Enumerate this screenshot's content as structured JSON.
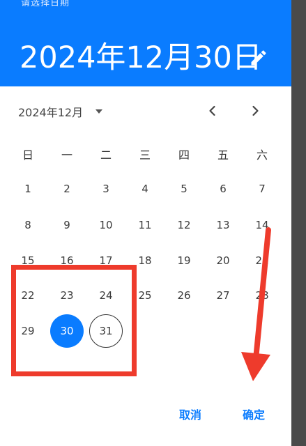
{
  "header": {
    "label": "请选择日期",
    "selected_date": "2024年12月30日",
    "edit_icon": "pencil-icon"
  },
  "calendar": {
    "month_label": "2024年12月",
    "dropdown_icon": "triangle-down-icon",
    "prev_icon": "chevron-left-icon",
    "next_icon": "chevron-right-icon",
    "weekdays": [
      "日",
      "一",
      "二",
      "三",
      "四",
      "五",
      "六"
    ],
    "days": [
      "1",
      "2",
      "3",
      "4",
      "5",
      "6",
      "7",
      "8",
      "9",
      "10",
      "11",
      "12",
      "13",
      "14",
      "15",
      "16",
      "17",
      "18",
      "19",
      "20",
      "21",
      "22",
      "23",
      "24",
      "25",
      "26",
      "27",
      "28",
      "29",
      "30",
      "31"
    ],
    "selected_day": "30",
    "today_day": "31"
  },
  "actions": {
    "cancel_label": "取消",
    "confirm_label": "确定"
  },
  "colors": {
    "accent": "#0a7cff",
    "annotation": "#ee3b2c"
  }
}
